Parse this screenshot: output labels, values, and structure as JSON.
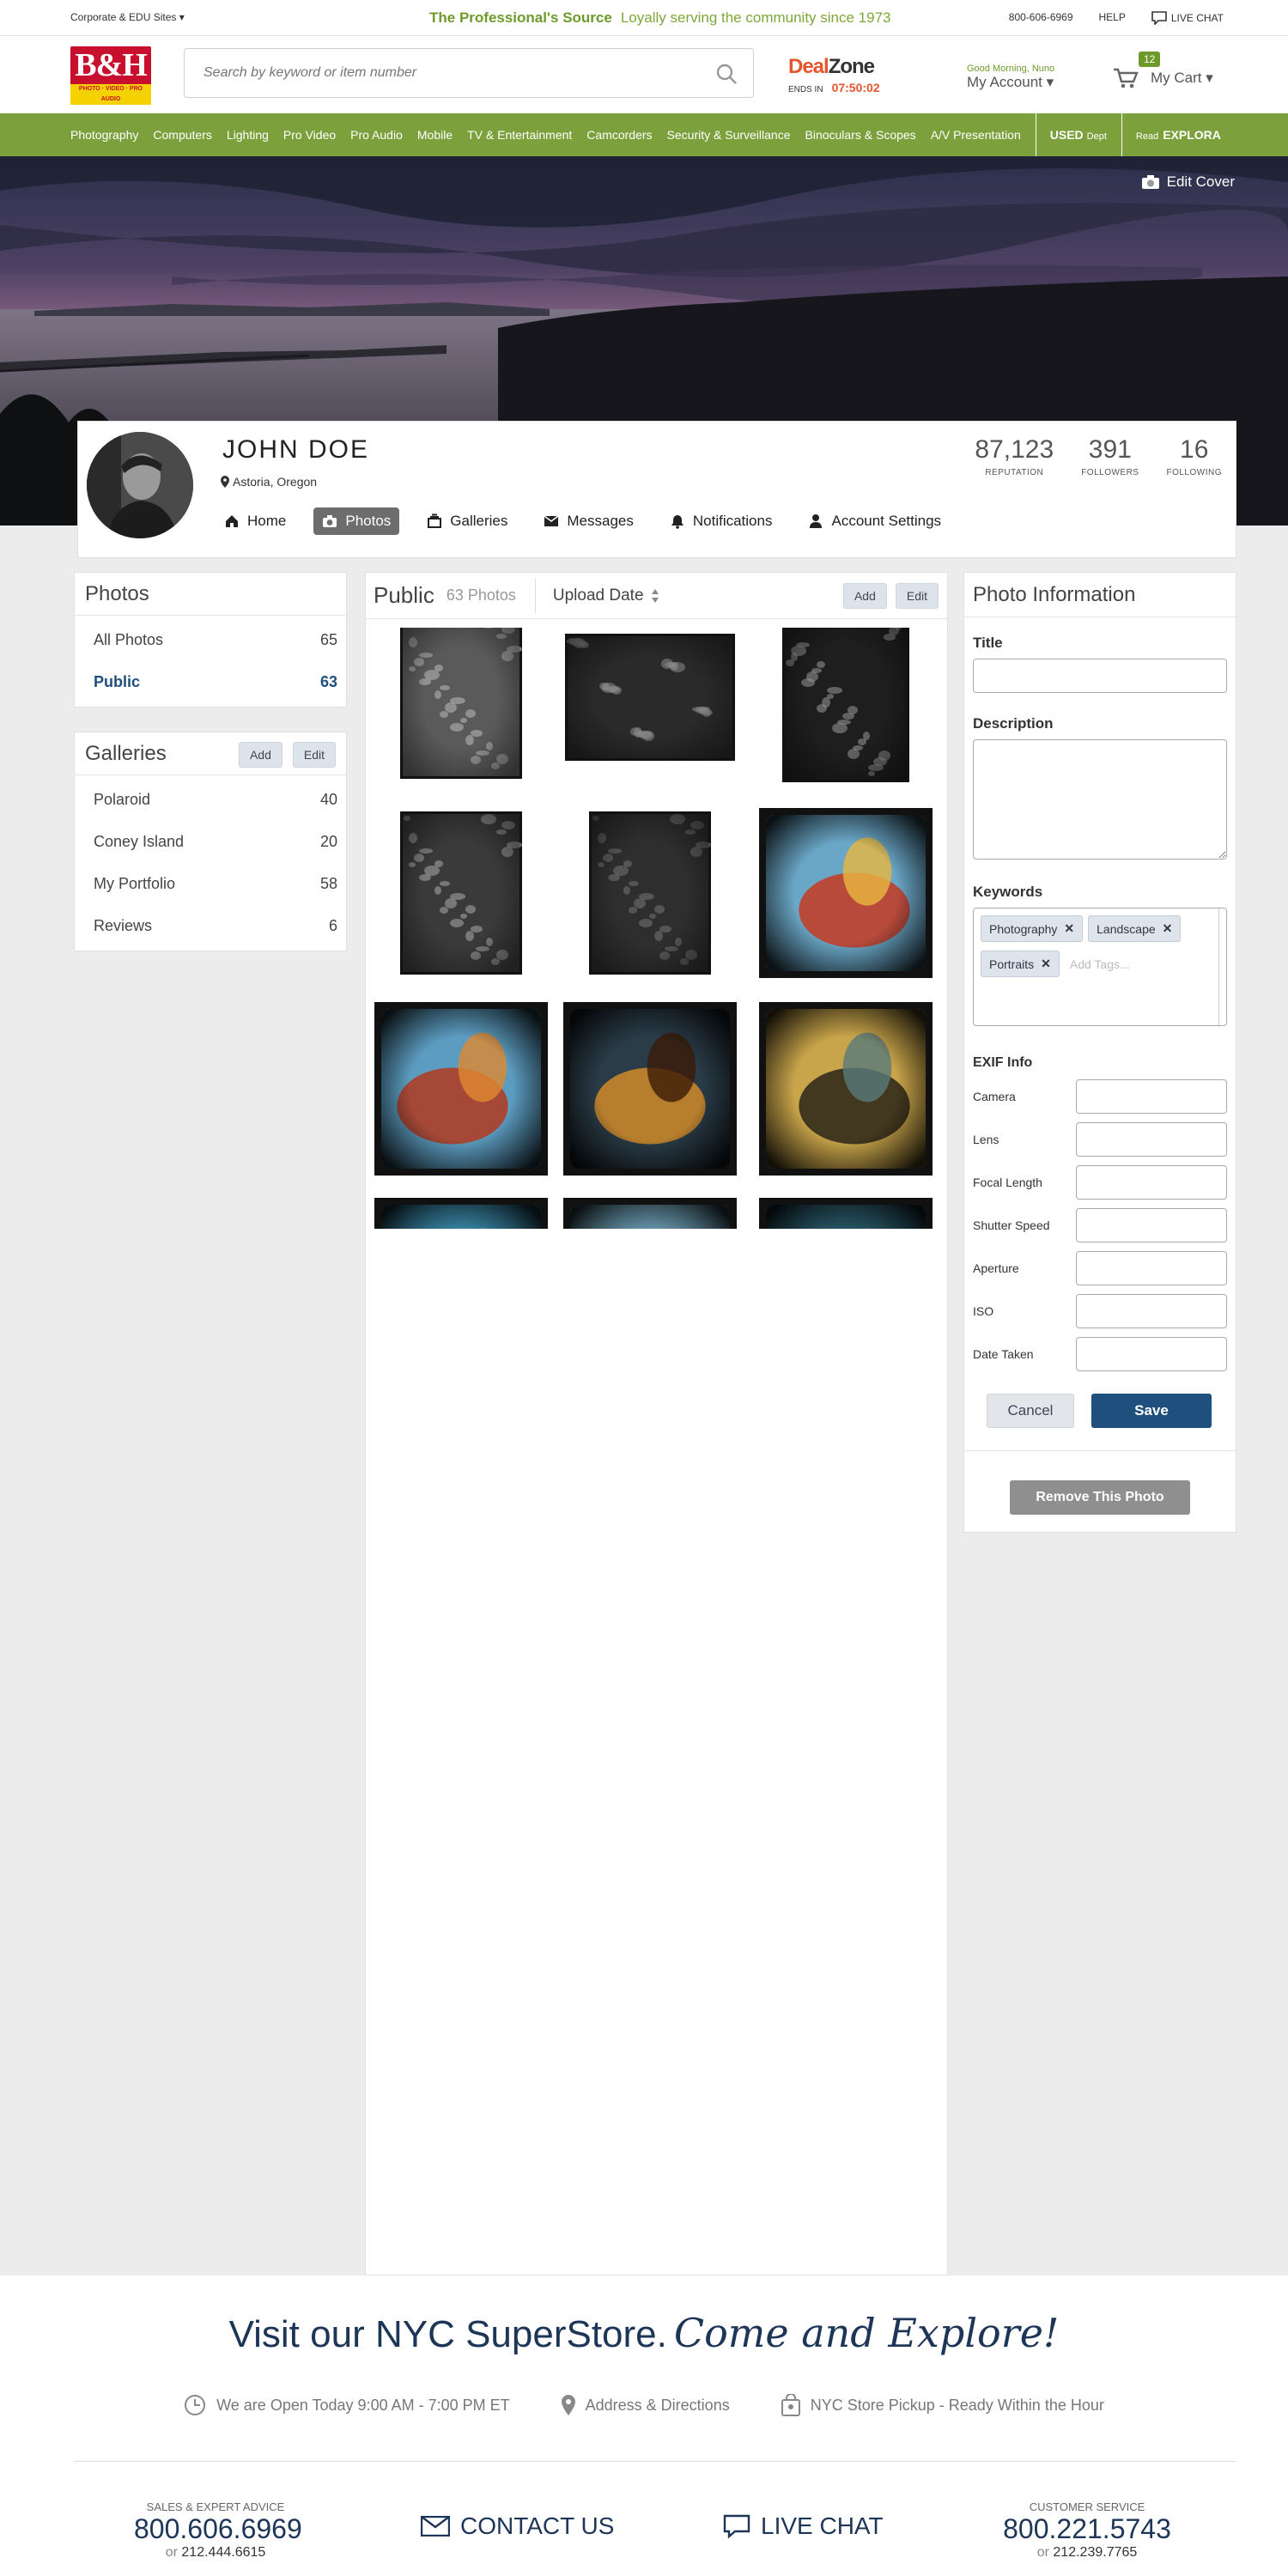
{
  "topbar": {
    "corporate": "Corporate & EDU Sites ▾",
    "slogan_bold": "The Professional's Source",
    "slogan_rest": "Loyally serving the community since 1973",
    "phone": "800-606-6969",
    "help": "HELP",
    "live_chat": "LIVE CHAT"
  },
  "header": {
    "logo_main": "B&H",
    "logo_sub": "PHOTO · VIDEO · PRO AUDIO",
    "search_placeholder": "Search by keyword or item number",
    "deal_a": "Deal",
    "deal_b": "Zone",
    "ends_label": "ENDS IN",
    "countdown": "07:50:02",
    "greeting": "Good Morning, Nuno",
    "my_account": "My Account ▾",
    "cart_count": "12",
    "cart_label": "My Cart ▾"
  },
  "nav": [
    "Photography",
    "Computers",
    "Lighting",
    "Pro Video",
    "Pro Audio",
    "Mobile",
    "TV & Entertainment",
    "Camcorders",
    "Security & Surveillance",
    "Binoculars & Scopes",
    "A/V Presentation"
  ],
  "nav_used": {
    "used": "USED",
    "dept": "Dept"
  },
  "nav_explora": {
    "read": "Read",
    "name": "EXPLORA"
  },
  "cover": {
    "edit": "Edit Cover"
  },
  "profile": {
    "name": "JOHN DOE",
    "location": "Astoria, Oregon",
    "stats": [
      {
        "n": "87,123",
        "l": "REPUTATION"
      },
      {
        "n": "391",
        "l": "FOLLOWERS"
      },
      {
        "n": "16",
        "l": "FOLLOWING"
      }
    ],
    "tabs": [
      "Home",
      "Photos",
      "Galleries",
      "Messages",
      "Notifications",
      "Account Settings"
    ]
  },
  "photos_panel": {
    "title": "Photos",
    "items": [
      {
        "label": "All Photos",
        "count": "65"
      },
      {
        "label": "Public",
        "count": "63"
      }
    ]
  },
  "galleries_panel": {
    "title": "Galleries",
    "add": "Add",
    "edit": "Edit",
    "items": [
      {
        "label": "Polaroid",
        "count": "40"
      },
      {
        "label": "Coney Island",
        "count": "20"
      },
      {
        "label": "My Portfolio",
        "count": "58"
      },
      {
        "label": "Reviews",
        "count": "6"
      }
    ]
  },
  "grid": {
    "title": "Public",
    "count": "63 Photos",
    "sort": "Upload Date",
    "add": "Add",
    "edit": "Edit"
  },
  "info": {
    "title": "Photo Information",
    "title_label": "Title",
    "desc_label": "Description",
    "kw_label": "Keywords",
    "keywords": [
      "Photography",
      "Landscape",
      "Portraits"
    ],
    "kw_placeholder": "Add Tags...",
    "exif_label": "EXIF Info",
    "exif": [
      "Camera",
      "Lens",
      "Focal Length",
      "Shutter Speed",
      "Aperture",
      "ISO",
      "Date Taken"
    ],
    "cancel": "Cancel",
    "save": "Save",
    "remove": "Remove This Photo"
  },
  "footer": {
    "visit": "Visit our NYC SuperStore.",
    "explore": "Come and Explore!",
    "hours": "We are Open Today 9:00 AM - 7:00 PM ET",
    "address": "Address & Directions",
    "pickup": "NYC Store Pickup - Ready Within the Hour",
    "sales_label": "SALES & EXPERT ADVICE",
    "sales_phone": "800.606.6969",
    "sales_or": "or",
    "sales_alt": "212.444.6615",
    "contact": "CONTACT US",
    "chat": "LIVE CHAT",
    "cs_label": "CUSTOMER SERVICE",
    "cs_phone": "800.221.5743",
    "cs_or": "or",
    "cs_alt": "212.239.7765"
  }
}
